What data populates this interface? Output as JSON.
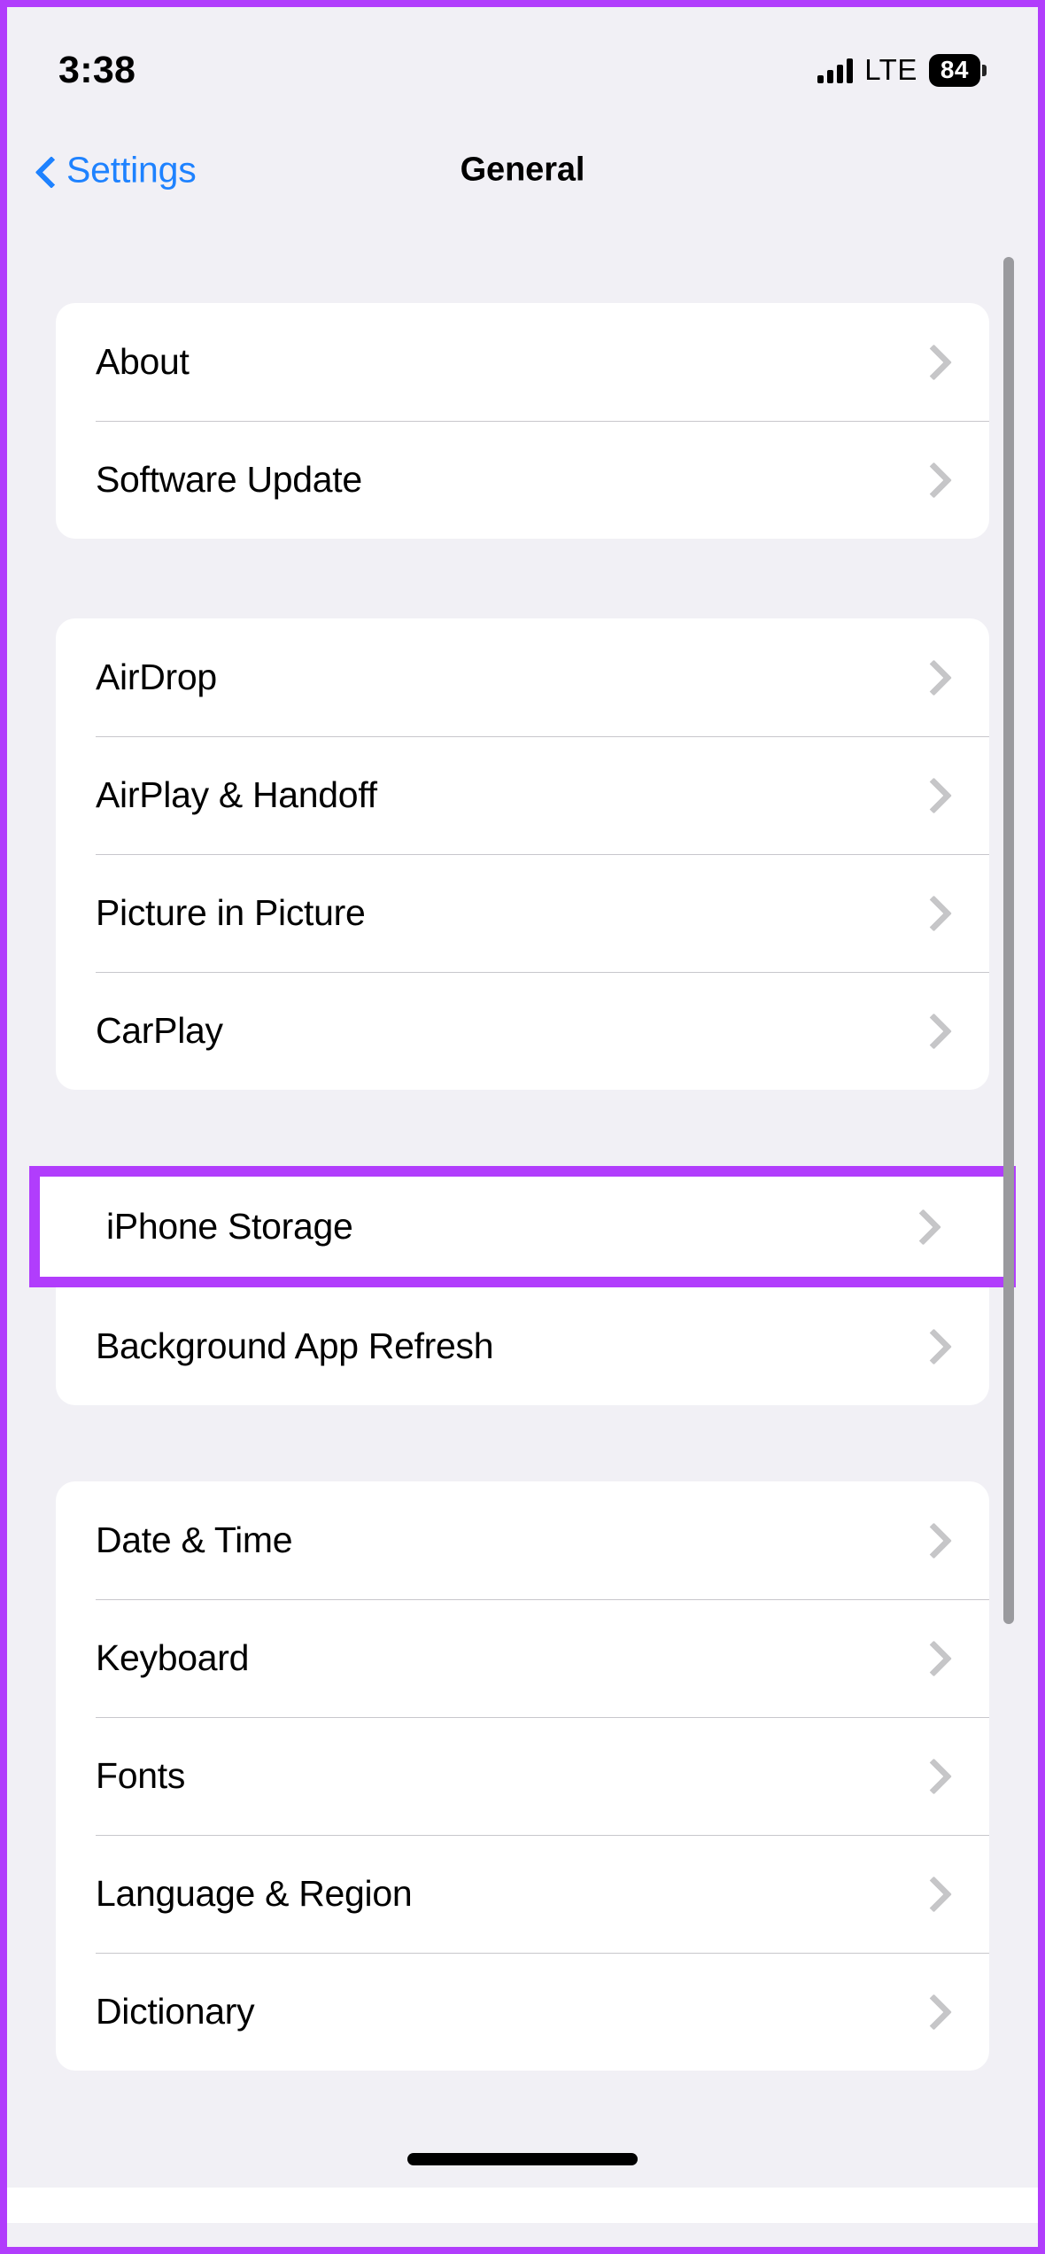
{
  "status_bar": {
    "time": "3:38",
    "network_label": "LTE",
    "battery_level": "84",
    "signal_icon": "cellular-signal-icon",
    "battery_icon": "battery-icon"
  },
  "nav": {
    "back_label": "Settings",
    "back_icon": "chevron-left-icon",
    "title": "General"
  },
  "colors": {
    "accent_blue": "#1E82FF",
    "highlight_purple": "#B13DFC",
    "page_background": "#F1F0F5",
    "card_background": "#FFFFFF",
    "chevron_gray": "#C6C6C8",
    "separator_gray": "#C8C7CC",
    "scrollbar_gray": "#9A9A9E"
  },
  "groups": [
    {
      "id": "group-info",
      "rows": [
        {
          "label": "About",
          "chevron_icon": "chevron-right-icon"
        },
        {
          "label": "Software Update",
          "chevron_icon": "chevron-right-icon"
        }
      ]
    },
    {
      "id": "group-connectivity",
      "rows": [
        {
          "label": "AirDrop",
          "chevron_icon": "chevron-right-icon"
        },
        {
          "label": "AirPlay & Handoff",
          "chevron_icon": "chevron-right-icon"
        },
        {
          "label": "Picture in Picture",
          "chevron_icon": "chevron-right-icon"
        },
        {
          "label": "CarPlay",
          "chevron_icon": "chevron-right-icon"
        }
      ]
    },
    {
      "id": "group-storage",
      "highlighted_row": {
        "label": "iPhone Storage",
        "chevron_icon": "chevron-right-icon"
      },
      "rows": [
        {
          "label": "Background App Refresh",
          "chevron_icon": "chevron-right-icon"
        }
      ]
    },
    {
      "id": "group-localization",
      "rows": [
        {
          "label": "Date & Time",
          "chevron_icon": "chevron-right-icon"
        },
        {
          "label": "Keyboard",
          "chevron_icon": "chevron-right-icon"
        },
        {
          "label": "Fonts",
          "chevron_icon": "chevron-right-icon"
        },
        {
          "label": "Language & Region",
          "chevron_icon": "chevron-right-icon"
        },
        {
          "label": "Dictionary",
          "chevron_icon": "chevron-right-icon"
        }
      ]
    }
  ]
}
